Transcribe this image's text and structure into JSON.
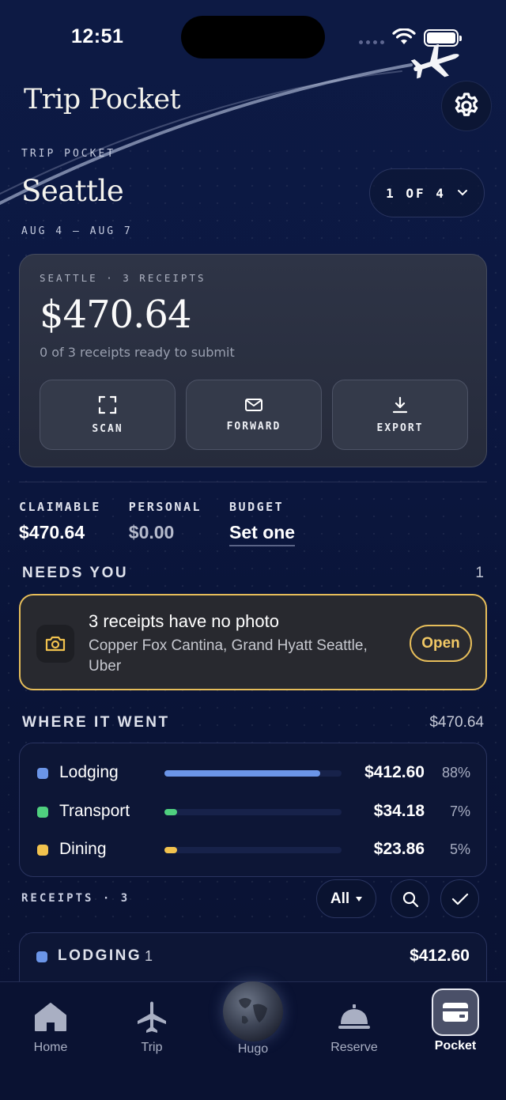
{
  "status_bar": {
    "time": "12:51"
  },
  "header": {
    "app_title": "Trip Pocket"
  },
  "trip": {
    "eyebrow": "TRIP POCKET",
    "city": "Seattle",
    "dates": "AUG 4 — AUG 7",
    "pager": "1 OF 4"
  },
  "summary_card": {
    "eyebrow": "SEATTLE · 3 RECEIPTS",
    "amount": "$470.64",
    "subtitle": "0 of 3 receipts ready to submit",
    "actions": [
      {
        "label": "SCAN",
        "icon": "scan-icon"
      },
      {
        "label": "FORWARD",
        "icon": "mail-icon"
      },
      {
        "label": "EXPORT",
        "icon": "download-icon"
      }
    ]
  },
  "stats": [
    {
      "label": "CLAIMABLE",
      "value": "$470.64"
    },
    {
      "label": "PERSONAL",
      "value": "$0.00"
    },
    {
      "label": "BUDGET",
      "value": "Set one"
    }
  ],
  "needs_you": {
    "title": "NEEDS YOU",
    "count": "1",
    "alert": {
      "title": "3 receipts have no photo",
      "body": "Copper Fox Cantina, Grand Hyatt Seattle, Uber",
      "button": "Open",
      "icon": "camera-icon"
    }
  },
  "where_it_went": {
    "title": "WHERE IT WENT",
    "total": "$470.64",
    "rows": [
      {
        "name": "Lodging",
        "amount": "$412.60",
        "percent": "88%",
        "share": 0.88,
        "color": "#6b95e8"
      },
      {
        "name": "Transport",
        "amount": "$34.18",
        "percent": "7%",
        "share": 0.07,
        "color": "#4fd07f"
      },
      {
        "name": "Dining",
        "amount": "$23.86",
        "percent": "5%",
        "share": 0.05,
        "color": "#f1c24e"
      }
    ]
  },
  "receipts": {
    "title": "RECEIPTS · 3",
    "filter": "All",
    "groups": [
      {
        "name": "LODGING",
        "count": "1",
        "amount": "$412.60"
      }
    ]
  },
  "tabbar": [
    {
      "label": "Home",
      "icon": "home-icon"
    },
    {
      "label": "Trip",
      "icon": "plane-icon"
    },
    {
      "label": "Hugo",
      "icon": "globe-icon"
    },
    {
      "label": "Reserve",
      "icon": "bell-icon"
    },
    {
      "label": "Pocket",
      "icon": "wallet-icon",
      "active": true
    }
  ]
}
